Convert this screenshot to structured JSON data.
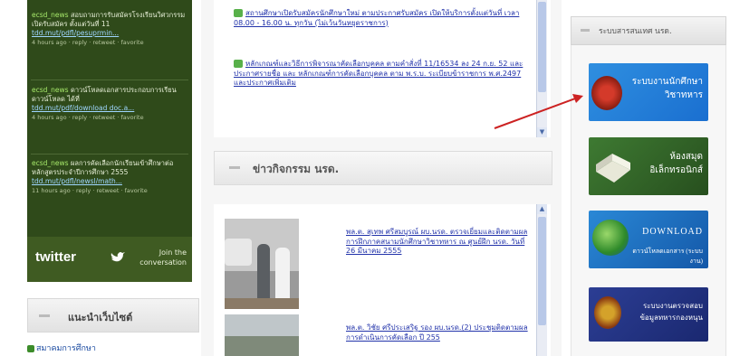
{
  "twitter": {
    "tweets": [
      {
        "user": "ecsd_news",
        "text": "สอบถามการรับสมัครโรงเรียนวิศวกรรม เปิดรับสมัคร ตั้งแต่วันที่ 11",
        "link": "tdd.mut/pdfl/pesuprmin...",
        "meta": "4 hours ago · reply · retweet · favorite"
      },
      {
        "user": "ecsd_news",
        "text": "ดาวน์โหลดเอกสารประกอบการเรียน ดาวน์โหลด ได้ที่",
        "link": "tdd.mut/pdf/download doc.a...",
        "meta": "4 hours ago · reply · retweet · favorite"
      },
      {
        "user": "ecsd_news",
        "text": "ผลการคัดเลือกนักเรียนเข้าศึกษาต่อ หลักสูตรประจำปีการศึกษา 2555",
        "link": "tdd.mut/pdfl/newsl/math...",
        "meta": "11 hours ago · reply · retweet · favorite"
      }
    ],
    "logo": "twitter",
    "join_text": "Join the conversation"
  },
  "left_box": {
    "title": "แนะนำเว็บไซต์",
    "link": "สมาคมการศึกษา"
  },
  "news": {
    "items": [
      "สถานศึกษาเปิดรับสมัครนักศึกษาใหม่ ตามประกาศรับสมัคร เปิดให้บริการตั้งแต่วันที่ เวลา 08.00 - 16.00 น. ทุกวัน (ไม่เว้นวันหยุดราชการ)",
      "หลักเกณฑ์และวิธีการพิจารณาคัดเลือกบุคคล ตามคำสั่งที่ 11/16534 ลง 24 ก.ย. 52 และประกาศรายชื่อ และ หลักเกณฑ์การคัดเลือกบุคคล ตาม พ.ร.บ. ระเบียบข้าราชการ พ.ศ.2497 และประกาศเพิ่มเติม"
    ]
  },
  "activity": {
    "title": "ข่าวกิจกรรม นรด.",
    "items": [
      "พล.ต. สุเทพ ศรีสมบูรณ์ ผบ.นรด. ตรวจเยี่ยมและติดตามผลการฝึกภาคสนามนักศึกษาวิชาทหาร ณ ศูนย์ฝึก นรด. วันที่ 26 มีนาคม 2555",
      "พล.ต. วิชัย ศรีประเสริฐ รอง ผบ.นรด.(2) ประชุมติดตามผลการดำเนินการคัดเลือก ปี 255"
    ]
  },
  "right": {
    "header": "ระบบสารสนเทศ นรด.",
    "banners": [
      "ระบบงานนักศึกษาวิชาทหาร",
      "ห้องสมุดอิเล็กทรอนิกส์",
      "DOWNLOAD",
      "ดาวน์โหลดเอกสาร (ระบบงาน)",
      "ระบบงานตรวจสอบข้อมูลทหารกองหนุน"
    ]
  },
  "colors": {
    "twitter_bg": "#2f4a1a",
    "link": "#2233aa",
    "annotation_arrow": "#cc2222"
  }
}
